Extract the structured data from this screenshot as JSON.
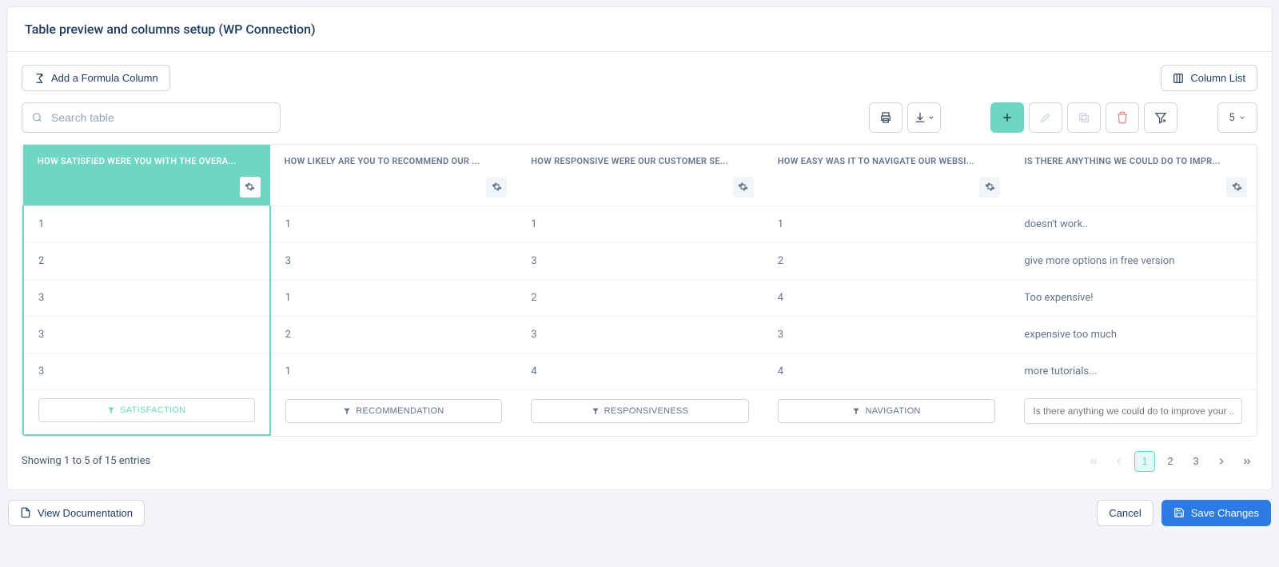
{
  "header": {
    "title": "Table preview and columns setup (WP Connection)"
  },
  "buttons": {
    "add_formula": "Add a Formula Column",
    "column_list": "Column List",
    "view_docs": "View Documentation",
    "cancel": "Cancel",
    "save": "Save Changes"
  },
  "search": {
    "placeholder": "Search table"
  },
  "page_size": "5",
  "columns": [
    {
      "header": "HOW SATISFIED WERE YOU WITH THE OVERA...",
      "filter": "SATISFACTION",
      "selected": true
    },
    {
      "header": "HOW LIKELY ARE YOU TO RECOMMEND OUR ...",
      "filter": "RECOMMENDATION",
      "selected": false
    },
    {
      "header": "HOW RESPONSIVE WERE OUR CUSTOMER SE...",
      "filter": "RESPONSIVENESS",
      "selected": false
    },
    {
      "header": "HOW EASY WAS IT TO NAVIGATE OUR WEBSI...",
      "filter": "NAVIGATION",
      "selected": false
    },
    {
      "header": "IS THERE ANYTHING WE COULD DO TO IMPR...",
      "filter_placeholder": "Is there anything we could do to improve your ...",
      "selected": false
    }
  ],
  "rows": [
    [
      "1",
      "1",
      "1",
      "1",
      "doesn't work.."
    ],
    [
      "2",
      "3",
      "3",
      "2",
      "give more options in free version"
    ],
    [
      "3",
      "1",
      "2",
      "4",
      "Too expensive!"
    ],
    [
      "3",
      "2",
      "3",
      "3",
      "expensive too much"
    ],
    [
      "3",
      "1",
      "4",
      "4",
      "more tutorials..."
    ]
  ],
  "footer": {
    "info": "Showing 1 to 5 of 15 entries"
  },
  "pagination": {
    "pages": [
      "1",
      "2",
      "3"
    ],
    "active": "1"
  }
}
